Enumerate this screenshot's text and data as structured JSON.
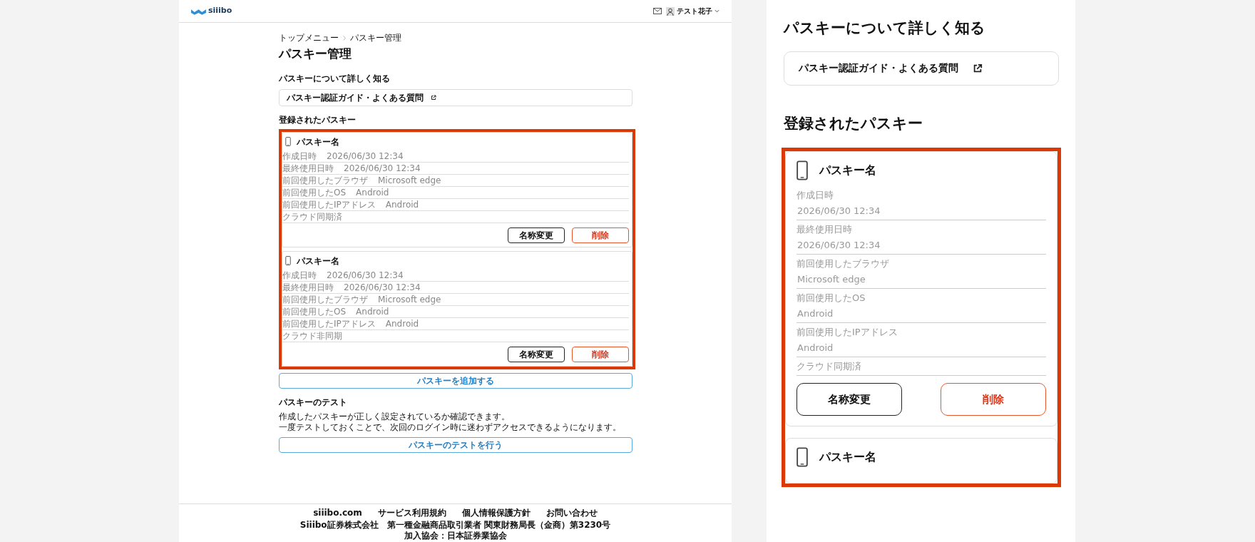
{
  "header": {
    "logo": "siiibo",
    "user": "テスト花子"
  },
  "breadcrumb": [
    {
      "label": "トップメニュー"
    },
    {
      "label": "パスキー管理"
    }
  ],
  "title": "パスキー管理",
  "learn": {
    "heading": "パスキーについて詳しく知る",
    "link": "パスキー認証ガイド・よくある質問"
  },
  "registered": {
    "heading": "登録されたパスキー",
    "cards": [
      {
        "title": "パスキー名",
        "rows": [
          {
            "label": "作成日時",
            "value": "2026/06/30 12:34"
          },
          {
            "label": "最終使用日時",
            "value": "2026/06/30 12:34"
          },
          {
            "label": "前回使用したブラウザ",
            "value": "Microsoft edge"
          },
          {
            "label": "前回使用したOS",
            "value": "Android"
          },
          {
            "label": "前回使用したIPアドレス",
            "value": "Android"
          },
          {
            "label": "クラウド同期済"
          }
        ],
        "buttons": [
          {
            "label": "名称変更",
            "kind": "outline"
          },
          {
            "label": "削除",
            "kind": "danger"
          }
        ]
      },
      {
        "title": "パスキー名",
        "rows": [
          {
            "label": "作成日時",
            "value": "2026/06/30 12:34"
          },
          {
            "label": "最終使用日時",
            "value": "2026/06/30 12:34"
          },
          {
            "label": "前回使用したブラウザ",
            "value": "Microsoft edge"
          },
          {
            "label": "前回使用したOS",
            "value": "Android"
          },
          {
            "label": "前回使用したIPアドレス",
            "value": "Android"
          },
          {
            "label": "クラウド非同期"
          }
        ],
        "buttons": [
          {
            "label": "名称変更",
            "kind": "outline"
          },
          {
            "label": "削除",
            "kind": "danger"
          }
        ]
      }
    ],
    "add_button": "パスキーを追加する"
  },
  "test": {
    "heading": "パスキーのテスト",
    "text": [
      "作成したパスキーが正しく設定されているか確認できます。",
      "一度テストしておくことで、次回のログイン時に迷わずアクセスできるようになります。"
    ],
    "button": "パスキーのテストを行う"
  },
  "footer": {
    "links": [
      "siiibo.com",
      "サービス利用規約",
      "個人情報保護方針",
      "お問い合わせ"
    ],
    "company": [
      "Siiibo証券株式会社　第一種金融商品取引業者 関東財務局長（金商）第3230号",
      "加入協会：日本証券業協会"
    ]
  },
  "zoom_view": {
    "learn": {
      "heading": "パスキーについて詳しく知る",
      "link": "パスキー認証ガイド・よくある質問"
    },
    "registered": {
      "heading": "登録されたパスキー",
      "cards": [
        {
          "title": "パスキー名",
          "rows": [
            {
              "label": "作成日時",
              "value": "2026/06/30 12:34"
            },
            {
              "label": "最終使用日時",
              "value": "2026/06/30 12:34"
            },
            {
              "label": "前回使用したブラウザ",
              "value": "Microsoft edge"
            },
            {
              "label": "前回使用したOS",
              "value": "Android"
            },
            {
              "label": "前回使用したIPアドレス",
              "value": "Android"
            },
            {
              "label": "クラウド同期済"
            }
          ],
          "buttons": [
            {
              "label": "名称変更",
              "kind": "outline"
            },
            {
              "label": "削除",
              "kind": "danger"
            }
          ]
        },
        {
          "title": "パスキー名"
        }
      ]
    }
  }
}
